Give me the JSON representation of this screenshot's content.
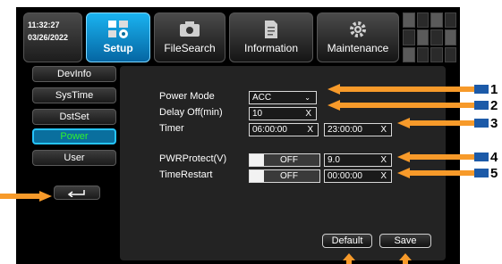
{
  "clock": {
    "time": "11:32:27",
    "date": "03/26/2022"
  },
  "tabs": [
    {
      "label": "Setup",
      "icon": "setup-icon",
      "active": true
    },
    {
      "label": "FileSearch",
      "icon": "camera-icon",
      "active": false
    },
    {
      "label": "Information",
      "icon": "document-icon",
      "active": false
    },
    {
      "label": "Maintenance",
      "icon": "gear-icon",
      "active": false
    }
  ],
  "sidebar": {
    "items": [
      {
        "label": "DevInfo"
      },
      {
        "label": "SysTime"
      },
      {
        "label": "DstSet"
      },
      {
        "label": "Power",
        "active": true
      },
      {
        "label": "User"
      }
    ]
  },
  "form": {
    "power_mode": {
      "label": "Power Mode",
      "value": "ACC"
    },
    "delay_off": {
      "label": "Delay Off(min)",
      "value": "10"
    },
    "timer": {
      "label": "Timer",
      "start": "06:00:00",
      "end": "23:00:00"
    },
    "pwr_protect": {
      "label": "PWRProtect(V)",
      "toggle": "OFF",
      "value": "9.0"
    },
    "time_restart": {
      "label": "TimeRestart",
      "toggle": "OFF",
      "value": "00:00:00"
    },
    "clear_glyph": "X"
  },
  "buttons": {
    "default": "Default",
    "save": "Save"
  },
  "callouts": [
    "1",
    "2",
    "3",
    "4",
    "5"
  ],
  "colors": {
    "accent": "#0a6f9e",
    "active_text": "#2ef22e",
    "arrow": "#f79a2a",
    "callout_bar": "#1c5aa8"
  }
}
